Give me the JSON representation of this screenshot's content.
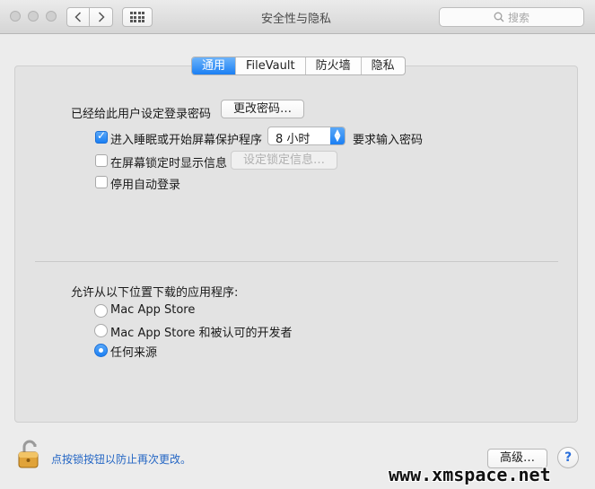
{
  "window": {
    "title": "安全性与隐私",
    "search_placeholder": "搜索"
  },
  "tabs": [
    {
      "label": "通用",
      "active": true
    },
    {
      "label": "FileVault",
      "active": false
    },
    {
      "label": "防火墙",
      "active": false
    },
    {
      "label": "隐私",
      "active": false
    }
  ],
  "general": {
    "password_label": "已经给此用户设定登录密码",
    "change_password_button": "更改密码…",
    "require_password": {
      "label_before": "进入睡眠或开始屏幕保护程序",
      "checked": true,
      "delay_value": "8 小时",
      "label_after": "要求输入密码"
    },
    "lock_message": {
      "label": "在屏幕锁定时显示信息",
      "checked": false,
      "button": "设定锁定信息…"
    },
    "disable_autologin": {
      "label": "停用自动登录",
      "checked": false
    },
    "downloads_heading": "允许从以下位置下载的应用程序:",
    "download_options": [
      {
        "label": "Mac App Store",
        "selected": false
      },
      {
        "label": "Mac App Store 和被认可的开发者",
        "selected": false
      },
      {
        "label": "任何来源",
        "selected": true
      }
    ]
  },
  "footer": {
    "lock_text": "点按锁按钮以防止再次更改。",
    "advanced_button": "高级…",
    "help_button": "?"
  },
  "watermark": "www.xmspace.net",
  "colors": {
    "accent": "#1b7ff3",
    "link": "#2466c4"
  }
}
